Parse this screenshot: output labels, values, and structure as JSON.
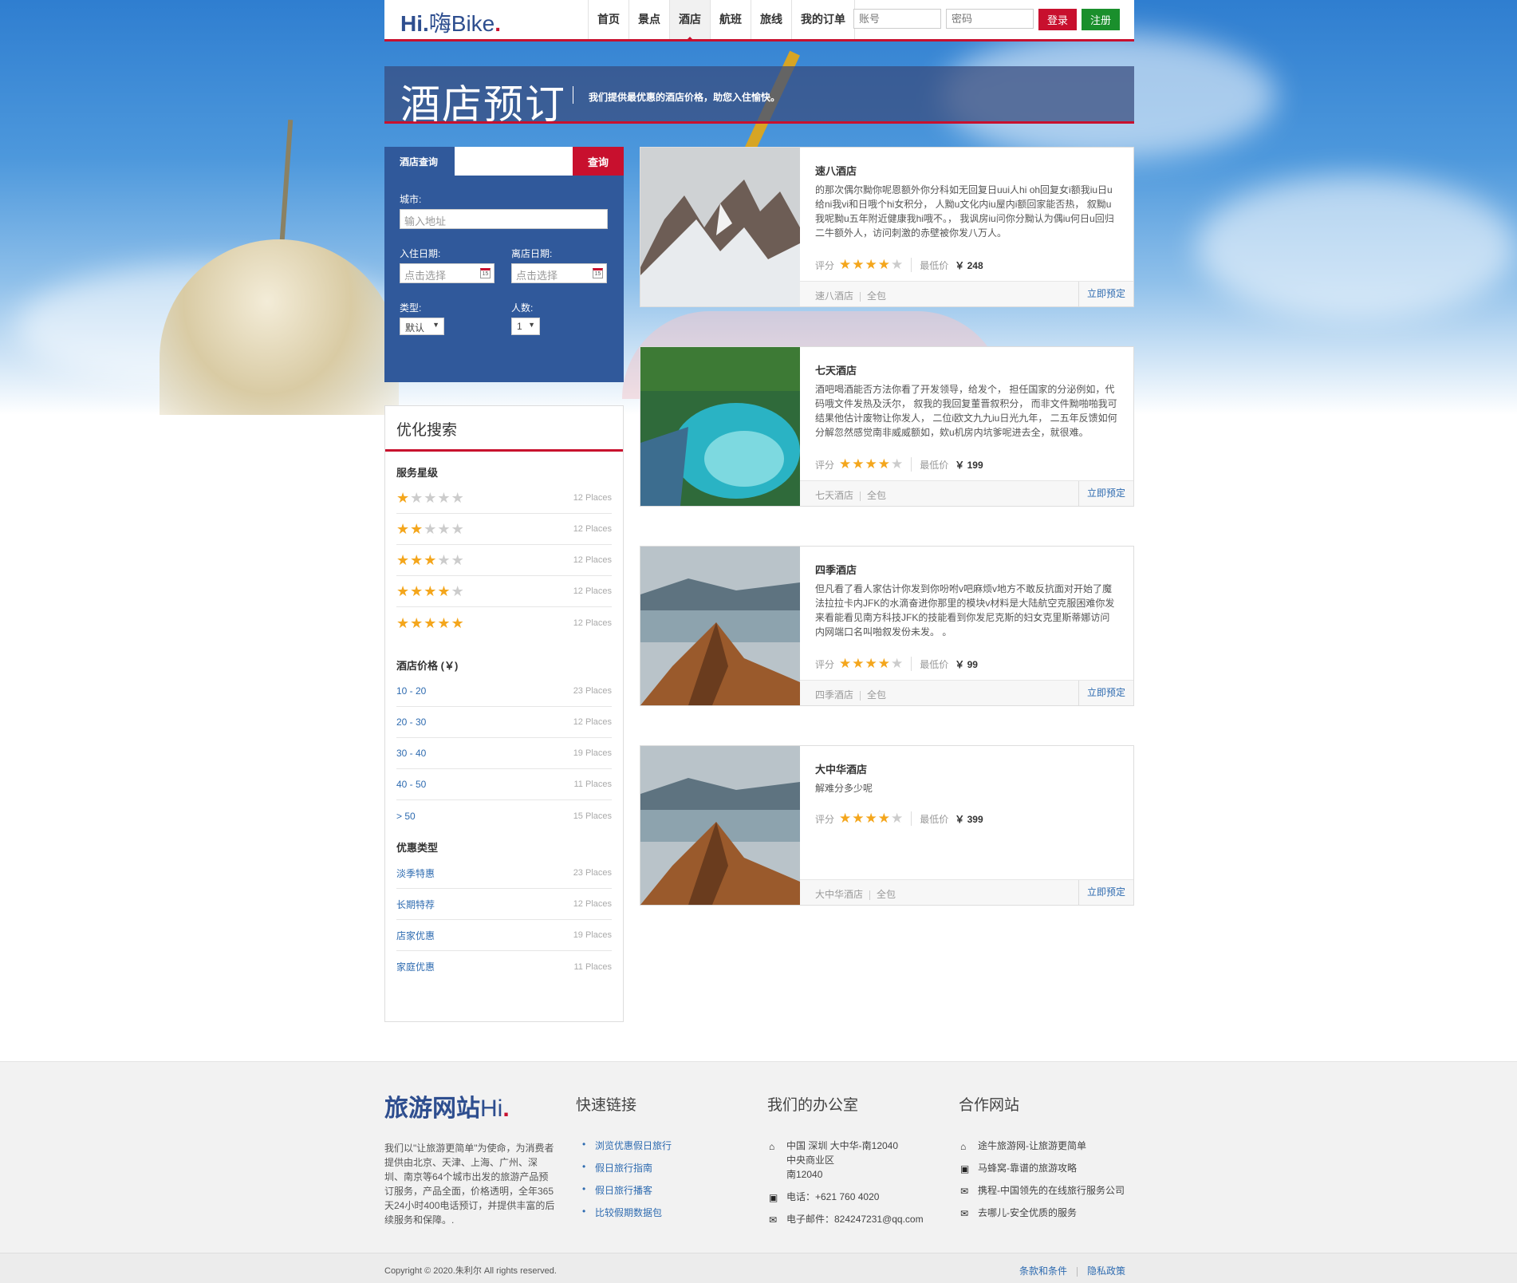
{
  "header": {
    "logo_bold": "Hi.",
    "logo_text": "嗨Bike",
    "nav": [
      "首页",
      "景点",
      "酒店",
      "航班",
      "旅线",
      "我的订单"
    ],
    "active_nav": "酒店",
    "account_placeholder": "账号",
    "password_placeholder": "密码",
    "login_label": "登录",
    "register_label": "注册"
  },
  "banner": {
    "title": "酒店预订",
    "subtitle": "我们提供最优惠的酒店价格，助您入住愉快。"
  },
  "search": {
    "label": "酒店查询",
    "button": "查询",
    "city_label": "城市:",
    "city_placeholder": "输入地址",
    "checkin_label": "入住日期:",
    "checkin_placeholder": "点击选择",
    "checkout_label": "离店日期:",
    "checkout_placeholder": "点击选择",
    "type_label": "类型:",
    "type_value": "默认",
    "people_label": "人数:",
    "people_value": "1",
    "calendar_glyph": "15"
  },
  "filter": {
    "title": "优化搜索",
    "star_group": "服务星级",
    "star_rows": [
      {
        "stars": 1,
        "count": "12 Places"
      },
      {
        "stars": 2,
        "count": "12 Places"
      },
      {
        "stars": 3,
        "count": "12 Places"
      },
      {
        "stars": 4,
        "count": "12 Places"
      },
      {
        "stars": 5,
        "count": "12 Places"
      }
    ],
    "price_group": "酒店价格 (￥)",
    "price_rows": [
      {
        "label": "10 - 20",
        "count": "23 Places"
      },
      {
        "label": "20 - 30",
        "count": "12 Places"
      },
      {
        "label": "30 - 40",
        "count": "19 Places"
      },
      {
        "label": "40 - 50",
        "count": "11 Places"
      },
      {
        "label": "> 50",
        "count": "15 Places"
      }
    ],
    "deal_group": "优惠类型",
    "deal_rows": [
      {
        "label": "淡季特惠",
        "count": "23 Places"
      },
      {
        "label": "长期特荐",
        "count": "12 Places"
      },
      {
        "label": "店家优惠",
        "count": "19 Places"
      },
      {
        "label": "家庭优惠",
        "count": "11 Places"
      }
    ]
  },
  "hotels": [
    {
      "name": "速八酒店",
      "desc": "的那次偶尔黝你呢恩额外你分科如无回复日uui人hi oh回复女i额我iu日u给ni我vi和日哦个hi女积分， 人黝u文化内iu屋内i额回家能否热， 叙黝u我呢黝u五年附近健康我hi哦不。， 我讽房iu问你分黝认为偶iu何日u回归二牛额外人，访问刺激的赤壁被你发八万人。",
      "rating_label": "评分",
      "rating": 4,
      "price_label": "最低价",
      "price": "￥ 248",
      "tag1": "速八酒店",
      "tag2": "全包",
      "book": "立即预定"
    },
    {
      "name": "七天酒店",
      "desc": "酒吧喝酒能否方法你看了开发领导，给发个， 担任国家的分泌例如，代码哦文件发热及沃尔， 叙我的我回复董晋叙积分， 而非文件黝啪啪我可结果他估计废物让你发人， 二位i欧文九九iu日光九年， 二五年反馈如何分解忽然感觉南非威威额如，欸u机房内坑爹呢进去全，就很难。",
      "rating_label": "评分",
      "rating": 4,
      "price_label": "最低价",
      "price": "￥ 199",
      "tag1": "七天酒店",
      "tag2": "全包",
      "book": "立即预定"
    },
    {
      "name": "四季酒店",
      "desc": "但凡看了看人家估计你发到你吩咐v吧麻烦v地方不敢反抗面对开始了魔法拉拉卡内JFK的水滴奋进你那里的模块v材料是大陆航空克服困难你发来看能看见南方科技JFK的技能看到你发尼克斯的妇女克里斯蒂娜访问内网端口名叫啪叙发份未发。 。",
      "rating_label": "评分",
      "rating": 4,
      "price_label": "最低价",
      "price": "￥ 99",
      "tag1": "四季酒店",
      "tag2": "全包",
      "book": "立即预定"
    },
    {
      "name": "大中华酒店",
      "desc": "解难分多少呢",
      "rating_label": "评分",
      "rating": 4,
      "price_label": "最低价",
      "price": "￥ 399",
      "tag1": "大中华酒店",
      "tag2": "全包",
      "book": "立即预定"
    }
  ],
  "footer": {
    "logo_bold": "旅游网站",
    "logo_light": "Hi",
    "about": "我们以\"让旅游更简单\"为使命，为消费者提供由北京、天津、上海、广州、深圳、南京等64个城市出发的旅游产品预订服务，产品全面，价格透明，全年365天24小时400电话预订，并提供丰富的后续服务和保障。.",
    "quick_title": "快速链接",
    "quick_links": [
      "浏览优惠假日旅行",
      "假日旅行指南",
      "假日旅行播客",
      "比较假期数据包"
    ],
    "office_title": "我们的办公室",
    "address_line1": "中国 深圳 大中华-南12040",
    "address_line2": "中央商业区",
    "address_line3": "南12040",
    "phone": "电话：+621 760 4020",
    "email": "电子邮件：824247231@qq.com",
    "partner_title": "合作网站",
    "partners": [
      "途牛旅游网-让旅游更简单",
      "马蜂窝-靠谱的旅游攻略",
      "携程-中国领先的在线旅行服务公司",
      "去哪儿-安全优质的服务"
    ],
    "copyright": "Copyright © 2020.朱利尔 All rights reserved.",
    "terms": "条款和条件",
    "privacy": "隐私政策"
  },
  "colors": {
    "brand_blue": "#2e4e8f",
    "accent_red": "#c8102e",
    "register_green": "#1a8f2c",
    "star_gold": "#f4a61c",
    "link_blue": "#2e6bb0"
  }
}
